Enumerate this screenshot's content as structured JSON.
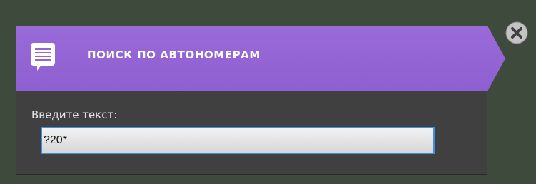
{
  "dialog": {
    "title": "ПОИСК ПО АВТОНОМЕРАМ",
    "field_label": "Введите текст:",
    "search_value": "?20*"
  },
  "icons": {
    "header": "document-icon",
    "close": "close-icon"
  },
  "colors": {
    "background": "#3e4b3c",
    "header": "#9565d6",
    "panel": "#404040",
    "input_border": "#3d8fe0"
  }
}
